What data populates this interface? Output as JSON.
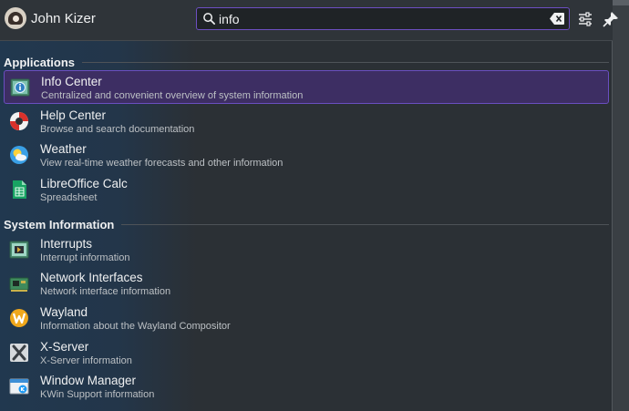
{
  "header": {
    "user_name": "John Kizer",
    "search_value": "info"
  },
  "sections": [
    {
      "heading": "Applications",
      "items": [
        {
          "title": "Info Center",
          "desc": "Centralized and convenient overview of system information",
          "icon": "info-center-icon"
        },
        {
          "title": "Help Center",
          "desc": "Browse and search documentation",
          "icon": "lifebuoy-icon"
        },
        {
          "title": "Weather",
          "desc": "View real-time weather forecasts and other information",
          "icon": "weather-icon"
        },
        {
          "title": "LibreOffice Calc",
          "desc": "Spreadsheet",
          "icon": "spreadsheet-icon"
        }
      ]
    },
    {
      "heading": "System Information",
      "items": [
        {
          "title": "Interrupts",
          "desc": "Interrupt information",
          "icon": "interrupts-icon"
        },
        {
          "title": "Network Interfaces",
          "desc": "Network interface information",
          "icon": "network-card-icon"
        },
        {
          "title": "Wayland",
          "desc": "Information about the Wayland Compositor",
          "icon": "wayland-icon"
        },
        {
          "title": "X-Server",
          "desc": "X-Server information",
          "icon": "x-server-icon"
        },
        {
          "title": "Window Manager",
          "desc": "KWin Support information",
          "icon": "window-manager-icon"
        }
      ]
    }
  ],
  "colors": {
    "accent": "#6a4fc0",
    "selected_bg": "#3d2e63",
    "background": "#2b3035"
  }
}
